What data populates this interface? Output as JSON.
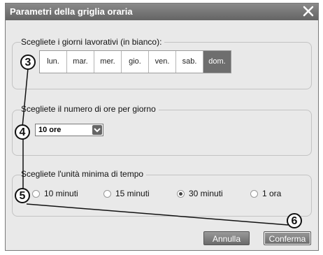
{
  "dialog": {
    "title": "Parametri della griglia oraria"
  },
  "workdays": {
    "legend": "Scegliete i giorni lavorativi (in bianco):",
    "days": [
      "lun.",
      "mar.",
      "mer.",
      "gio.",
      "ven.",
      "sab.",
      "dom."
    ]
  },
  "hours": {
    "legend": "Scegliete il numero di ore per giorno",
    "selected": "10 ore"
  },
  "unit": {
    "legend": "Scegliete l'unità minima di tempo",
    "options": [
      "10 minuti",
      "15 minuti",
      "30 minuti",
      "1 ora"
    ],
    "selected_index": 2
  },
  "buttons": {
    "cancel": "Annulla",
    "confirm": "Conferma"
  },
  "callouts": [
    "3",
    "4",
    "5",
    "6"
  ],
  "colors": {
    "titlebar": "#6e6e6e",
    "dialog_bg": "#e9e9e9",
    "off_day": "#6e6e6e"
  }
}
